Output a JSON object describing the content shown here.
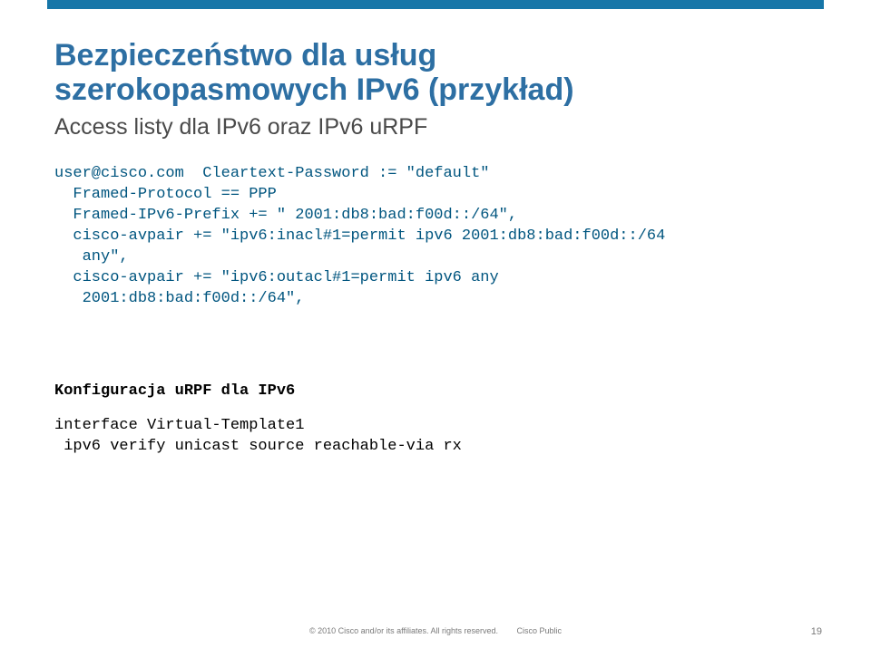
{
  "title_line1": "Bezpieczeństwo dla usług",
  "title_line2": "szerokopasmowych IPv6 (przykład)",
  "subtitle": "Access listy dla IPv6 oraz IPv6 uRPF",
  "code_block1": "user@cisco.com  Cleartext-Password := \"default\"\n  Framed-Protocol == PPP\n  Framed-IPv6-Prefix += \" 2001:db8:bad:f00d::/64\",\n  cisco-avpair += \"ipv6:inacl#1=permit ipv6 2001:db8:bad:f00d::/64\n   any\",\n  cisco-avpair += \"ipv6:outacl#1=permit ipv6 any\n   2001:db8:bad:f00d::/64\",",
  "urpf_heading": "Konfiguracja uRPF  dla IPv6",
  "code_block2": "interface Virtual-Template1\n ipv6 verify unicast source reachable-via rx",
  "footer_copyright": "© 2010 Cisco and/or its affiliates. All rights reserved.",
  "footer_public": "Cisco Public",
  "page_number": "19"
}
